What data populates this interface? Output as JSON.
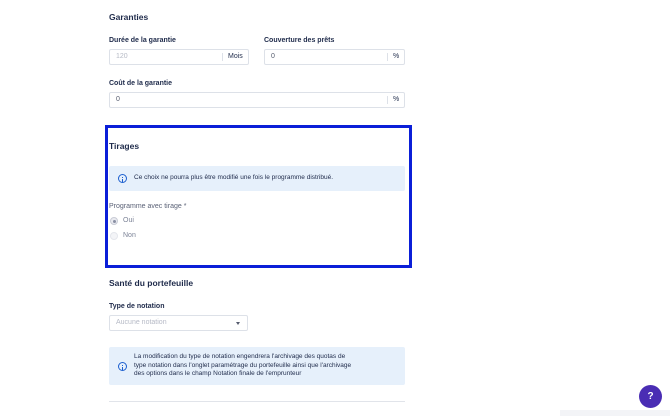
{
  "garanties": {
    "title": "Garanties",
    "duree": {
      "label": "Durée de la garantie",
      "placeholder": "120",
      "suffix": "Mois"
    },
    "couverture": {
      "label": "Couverture des prêts",
      "value": "0",
      "suffix": "%"
    },
    "cout": {
      "label": "Coût de la garantie",
      "value": "0",
      "suffix": "%"
    }
  },
  "tirages": {
    "title": "Tirages",
    "info": "Ce choix ne pourra plus être modifié une fois le programme distribué.",
    "programme_label": "Programme avec tirage",
    "required_mark": "*",
    "options": [
      {
        "label": "Oui",
        "checked": true
      },
      {
        "label": "Non",
        "checked": false
      }
    ]
  },
  "sante": {
    "title": "Santé du portefeuille",
    "notation_label": "Type de notation",
    "notation_placeholder": "Aucune notation",
    "info_lines": [
      "La modification du type de notation engendrera l'archivage des quotas de",
      "type notation dans l'onglet paramétrage du portefeuille ainsi que l'archivage",
      "des options dans le champ Notation finale de l'emprunteur"
    ]
  },
  "help": {
    "label": "?"
  }
}
